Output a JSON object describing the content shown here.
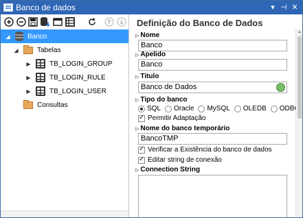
{
  "window": {
    "title": "Banco de dados",
    "buttons": [
      "▾",
      "⊣",
      "✕"
    ]
  },
  "toolbar": {
    "icons": [
      "add-icon",
      "remove-icon",
      "save-icon",
      "database-import-icon",
      "window-icon",
      "table-icon",
      "refresh-icon",
      "move-up-icon",
      "move-down-icon"
    ]
  },
  "tree": {
    "root": "Banco",
    "tabelas": "Tabelas",
    "tables": [
      "TB_LOGIN_GROUP",
      "TB_LOGIN_RULE",
      "TB_LOGIN_USER"
    ],
    "consultas": "Consultas"
  },
  "props": {
    "header": "Definição do Banco de Dados",
    "nome_label": "Nome",
    "nome_value": "Banco",
    "apelido_label": "Apelido",
    "apelido_value": "Banco",
    "titulo_label": "Titulo",
    "titulo_value": "Banco de Dados",
    "tipo_label": "Tipo do banco",
    "tipo_options": [
      "SQL",
      "Oracle",
      "MySQL",
      "OLEDB",
      "ODBC"
    ],
    "tipo_selected": "SQL",
    "permitir": "Permitir Adaptação",
    "temp_label": "Nome do banco temporário",
    "temp_value": "BancoTMP",
    "verificar": "Verificar a Existência do banco de dados",
    "editar": "Editar string de conexão",
    "conn_label": "Connection String",
    "conn_value": ""
  }
}
